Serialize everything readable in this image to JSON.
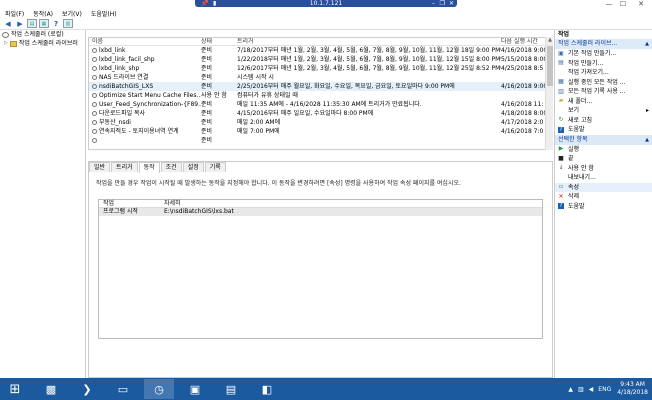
{
  "remote_bar": {
    "title": "10.1.7.121"
  },
  "window_controls": {
    "minimize": "—",
    "maximize": "☐",
    "close": "✕"
  },
  "menu": [
    "파일(F)",
    "동작(A)",
    "보기(V)",
    "도움말(H)"
  ],
  "tree": [
    {
      "label": "작업 스케줄러 (로컬)"
    },
    {
      "label": "작업 스케줄러 라이브러"
    }
  ],
  "task_table": {
    "headers": [
      "이름",
      "상태",
      "트리거",
      "다음 실행 시간"
    ],
    "rows": [
      {
        "name": "lxbd_link",
        "status": "준비",
        "trigger": "7/18/2017부터 매년 1월, 2월, 3월, 4월, 5월, 6월, 7월, 8월, 9월, 10월, 11월, 12월 18일 9:00 PM에",
        "next": "4/16/2018 9:00"
      },
      {
        "name": "lxbd_link_facil_shp",
        "status": "준비",
        "trigger": "1/22/2018부터 매년 1월, 2월, 3월, 4월, 5월, 6월, 7월, 8월, 9월, 10월, 11월, 12월 15일 8:00 PM에",
        "next": "5/15/2018 8:00"
      },
      {
        "name": "lxbd_link_shp",
        "status": "준비",
        "trigger": "12/6/2017부터 매년 1월, 2월, 3월, 4월, 5월, 6월, 7월, 8월, 9월, 10월, 11월, 12월 25일 8:52 PM에",
        "next": "4/25/2018 8:5"
      },
      {
        "name": "NAS 드라이브 연결",
        "status": "준비",
        "trigger": "시스템 시작 시",
        "next": ""
      },
      {
        "name": "nsdiBatchGIS_LXS",
        "status": "준비",
        "trigger": "2/25/2016부터 매주 월요일, 화요일, 수요일, 목요일, 금요일, 토요일마다 9:00 PM에",
        "next": "4/16/2018 9:00",
        "selected": true
      },
      {
        "name": "Optimize Start Menu Cache Files...",
        "status": "사용 안 함",
        "trigger": "컴퓨터가 유휴 상태일 때",
        "next": ""
      },
      {
        "name": "User_Feed_Synchronization-{F89...",
        "status": "준비",
        "trigger": "매일 11:35 AM에 - 4/16/2028 11:35:30 AM에 트리거가 만료됩니다.",
        "next": "4/16/2018 11:"
      },
      {
        "name": "다운로드파일 복사",
        "status": "준비",
        "trigger": "4/15/2016부터 매주 일요일, 수요일마다 8:00 PM에",
        "next": "4/18/2018 8:00"
      },
      {
        "name": "부동산_nsdi",
        "status": "준비",
        "trigger": "매일 2:00 AM에",
        "next": "4/17/2018 2:0"
      },
      {
        "name": "연속지적도 - 토지이용녀역 연계",
        "status": "준비",
        "trigger": "매일 7:00 PM에",
        "next": "4/16/2018 7:0"
      },
      {
        "name": "",
        "status": "준비",
        "trigger": "",
        "next": ""
      }
    ]
  },
  "detail": {
    "tabs": [
      "일반",
      "트리거",
      "동작",
      "조건",
      "설정",
      "기록"
    ],
    "active_tab": 2,
    "description": "작업을 만들 경우 작업이 시작될 때 발생하는 동작을 지정해야 합니다. 이 동작을 변경하려면 [속성] 명령을 사용하여 작업 속성 페이지를 여십시오.",
    "action_headers": [
      "작업",
      "자세히"
    ],
    "action_rows": [
      {
        "action": "프로그램 시작",
        "detail": "E:\\nsdiBatchGIS\\lxs.bat"
      }
    ]
  },
  "actions_pane": {
    "title": "작업",
    "section1": "작업 스케줄러 라이브...",
    "items1": [
      {
        "label": "기본 작업 만들기...",
        "icon": "basic-task-icon"
      },
      {
        "label": "작업 만들기...",
        "icon": "create-task-icon"
      },
      {
        "label": "작업 가져오기...",
        "icon": ""
      },
      {
        "label": "실행 중인 모든 작업 ...",
        "icon": "running-tasks-icon"
      },
      {
        "label": "모든 작업 기록 사용 ...",
        "icon": "history-icon"
      },
      {
        "label": "새 폴더...",
        "icon": "new-folder-icon"
      },
      {
        "label": "보기",
        "icon": "",
        "submenu": true
      },
      {
        "label": "새로 고침",
        "icon": "refresh-icon"
      },
      {
        "label": "도움말",
        "icon": "help-icon"
      }
    ],
    "section2": "선택한 항목",
    "items2": [
      {
        "label": "실행",
        "icon": "run-icon"
      },
      {
        "label": "끝",
        "icon": "end-icon"
      },
      {
        "label": "사용 안 함",
        "icon": "disable-icon"
      },
      {
        "label": "내보내기...",
        "icon": ""
      },
      {
        "label": "속성",
        "icon": "properties-icon",
        "highlight": true
      },
      {
        "label": "삭제",
        "icon": "delete-icon"
      },
      {
        "label": "도움말",
        "icon": "help-icon"
      }
    ]
  },
  "taskbar": {
    "tray": {
      "lang": "ENG",
      "time": "9:43 AM",
      "date": "4/18/2018"
    }
  },
  "colors": {
    "accent": "#1c5aa0",
    "section": "#ddeaf7",
    "selection": "#e5f0fb"
  }
}
